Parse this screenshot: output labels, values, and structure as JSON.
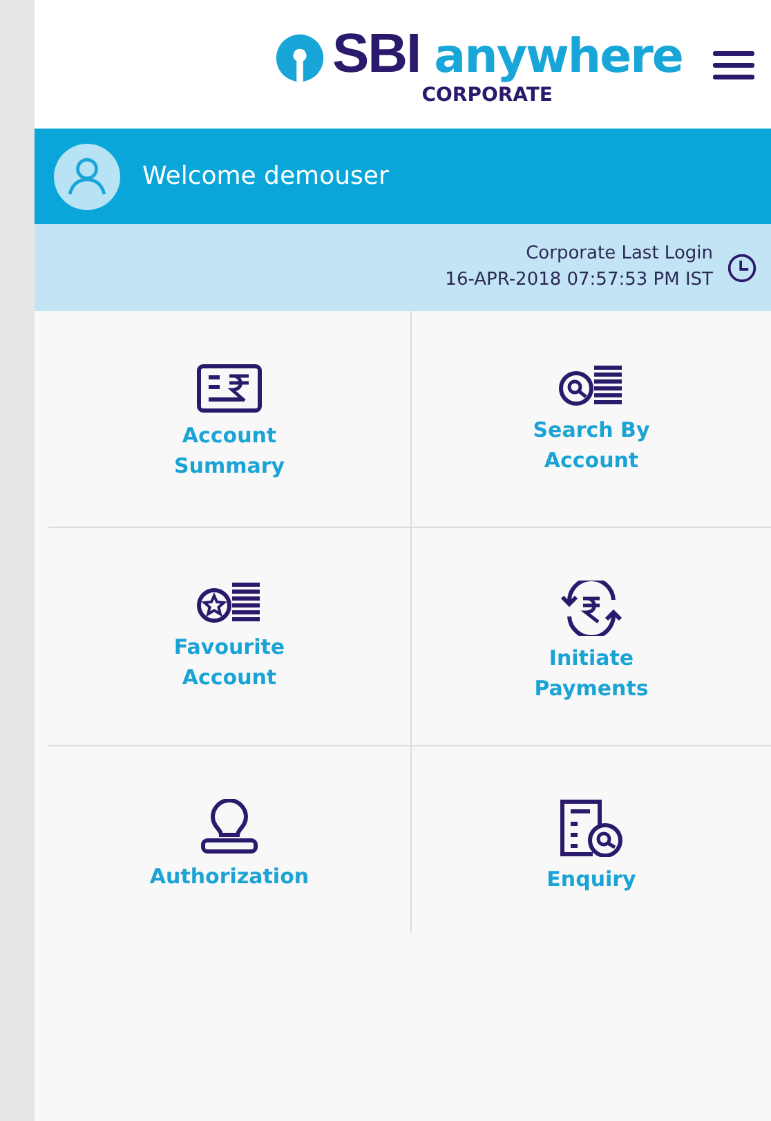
{
  "header": {
    "brand": "SBI",
    "product": "anywhere",
    "edition": "CORPORATE"
  },
  "welcome": {
    "text": "Welcome demouser"
  },
  "last_login": {
    "label": "Corporate Last Login",
    "timestamp": "16-APR-2018 07:57:53 PM IST"
  },
  "tiles": [
    {
      "kind": "summary",
      "label": "Account Summary"
    },
    {
      "kind": "search",
      "label": "Search By Account"
    },
    {
      "kind": "favourite",
      "label": "Favourite Account"
    },
    {
      "kind": "payments",
      "label": "Initiate Payments"
    },
    {
      "kind": "authorization",
      "label": "Authorization"
    },
    {
      "kind": "enquiry",
      "label": "Enquiry"
    }
  ]
}
